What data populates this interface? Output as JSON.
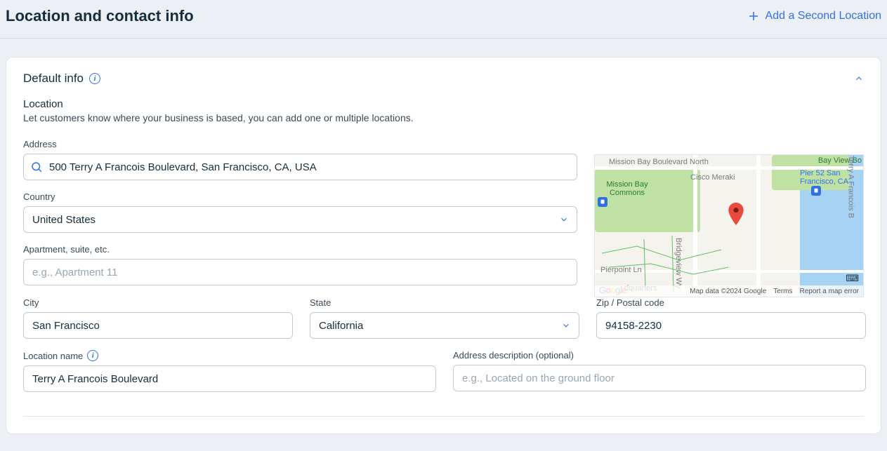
{
  "header": {
    "title": "Location and contact info",
    "add_location_label": "Add a Second Location"
  },
  "card": {
    "title": "Default info",
    "location_section": {
      "title": "Location",
      "description": "Let customers know where your business is based, you can add one or multiple locations."
    }
  },
  "fields": {
    "address": {
      "label": "Address",
      "value": "500 Terry A Francois Boulevard, San Francisco, CA, USA"
    },
    "country": {
      "label": "Country",
      "value": "United States"
    },
    "apartment": {
      "label": "Apartment, suite, etc.",
      "placeholder": "e.g., Apartment 11",
      "value": ""
    },
    "city": {
      "label": "City",
      "value": "San Francisco"
    },
    "state": {
      "label": "State",
      "value": "California"
    },
    "zip": {
      "label": "Zip / Postal code",
      "value": "94158-2230"
    },
    "location_name": {
      "label": "Location name",
      "value": "Terry A Francois Boulevard"
    },
    "address_desc": {
      "label": "Address description (optional)",
      "placeholder": "e.g., Located on the ground floor",
      "value": ""
    }
  },
  "map": {
    "labels": {
      "mission_bay_blvd": "Mission Bay Boulevard North",
      "commons": "Mission Bay Commons",
      "cisco": "Cisco Meraki",
      "pier": "Pier 52 San Francisco, CA",
      "bayview": "Bay View Bo",
      "pierpoint": "Pierpoint Ln",
      "bridgeview": "Bridgeview Wy",
      "terry": "Terry A Francois B",
      "hq": "dquarters"
    },
    "footer": {
      "attribution": "Map data ©2024 Google",
      "terms": "Terms",
      "report": "Report a map error"
    }
  }
}
